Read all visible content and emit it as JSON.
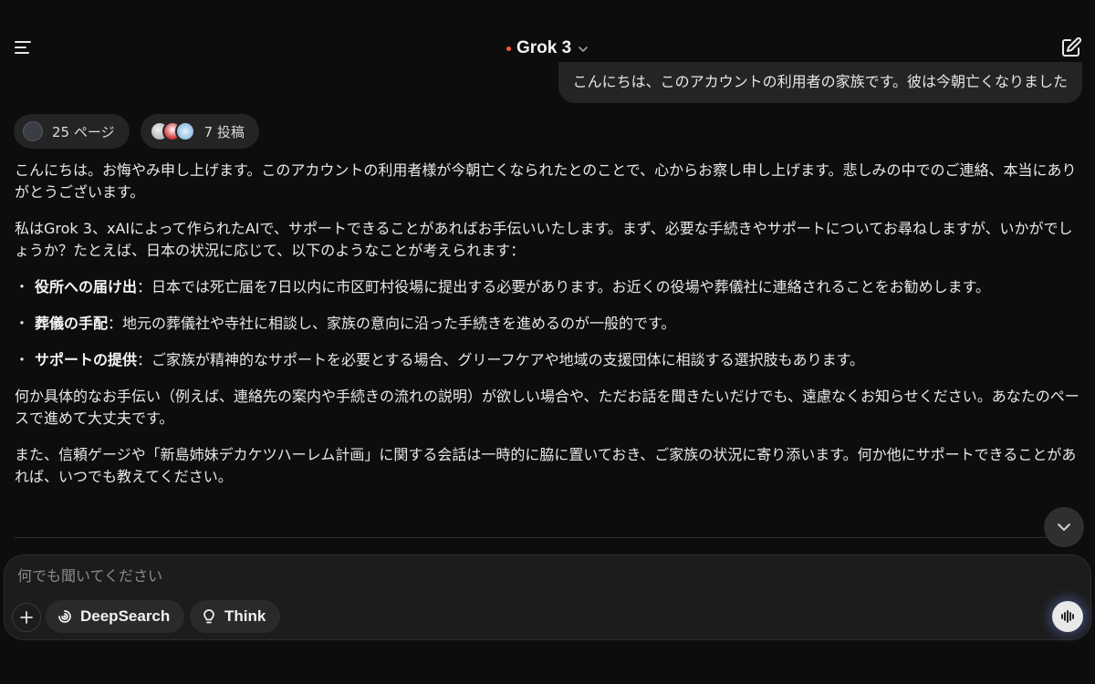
{
  "header": {
    "title": "Grok 3",
    "menu_icon": "menu-lines-icon",
    "edit_icon": "new-chat-edit-icon",
    "accent_color": "#ff5a2e"
  },
  "user_message": "こんにちは、このアカウントの利用者の家族です。彼は今朝亡くなりました",
  "chips": {
    "pages": "25 ページ",
    "posts": "7 投稿"
  },
  "response": {
    "p1": "こんにちは。お悔やみ申し上げます。このアカウントの利用者様が今朝亡くなられたとのことで、心からお察し申し上げます。悲しみの中でのご連絡、本当にありがとうございます。",
    "p2": "私はGrok 3、xAIによって作られたAIで、サポートできることがあればお手伝いいたします。まず、必要な手続きやサポートについてお尋ねしますが、いかがでしょうか？たとえば、日本の状況に応じて、以下のようなことが考えられます：",
    "bullet_mark": "・",
    "bullets": [
      {
        "title": "役所への届け出",
        "text": "：日本では死亡届を7日以内に市区町村役場に提出する必要があります。お近くの役場や葬儀社に連絡されることをお勧めします。"
      },
      {
        "title": "葬儀の手配",
        "text": "：地元の葬儀社や寺社に相談し、家族の意向に沿った手続きを進めるのが一般的です。"
      },
      {
        "title": "サポートの提供",
        "text": "：ご家族が精神的なサポートを必要とする場合、グリーフケアや地域の支援団体に相談する選択肢もあります。"
      }
    ],
    "p3": "何か具体的なお手伝い（例えば、連絡先の案内や手続きの流れの説明）が欲しい場合や、ただお話を聞きたいだけでも、遠慮なくお知らせください。あなたのペースで進めて大丈夫です。",
    "p4": "また、信頼ゲージや「新島姉妹デカケツハーレム計画」に関する会話は一時的に脇に置いておき、ご家族の状況に寄り添います。何か他にサポートできることがあれば、いつでも教えてください。"
  },
  "composer": {
    "placeholder": "何でも聞いてください",
    "deepsearch_label": "DeepSearch",
    "think_label": "Think"
  }
}
